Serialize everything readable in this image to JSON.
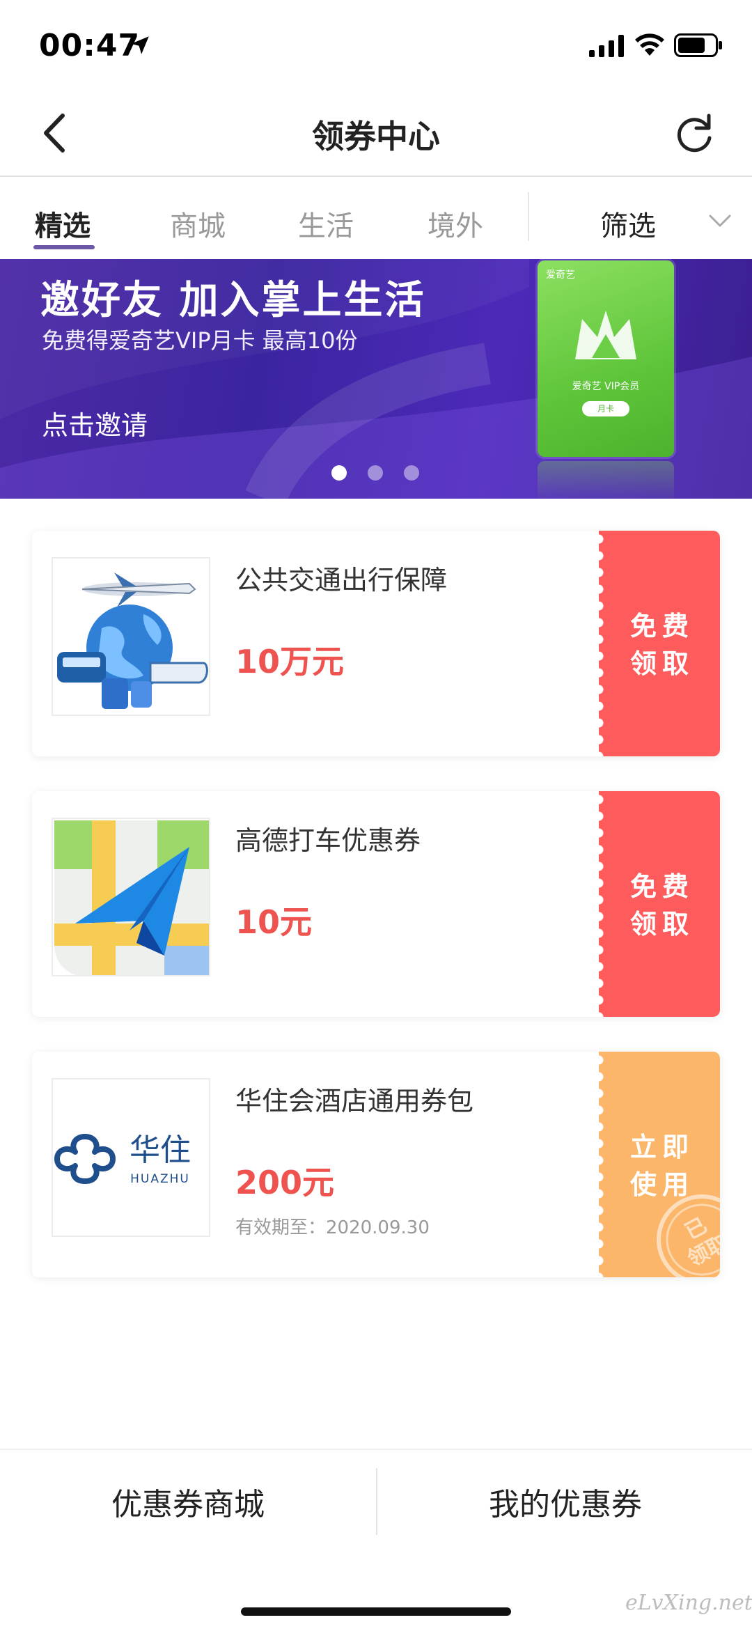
{
  "status_bar": {
    "time": "00:47"
  },
  "nav": {
    "title": "领券中心"
  },
  "tabs": {
    "items": [
      {
        "label": "精选"
      },
      {
        "label": "商城"
      },
      {
        "label": "生活"
      },
      {
        "label": "境外"
      }
    ],
    "filter_label": "筛选"
  },
  "banner": {
    "title": "邀好友 加入掌上生活",
    "subtitle": "免费得爱奇艺VIP月卡 最高10份",
    "cta": "点击邀请",
    "card": {
      "brand": "爱奇艺",
      "name": "爱奇艺 VIP会员",
      "tag": "月卡"
    },
    "dots_count": 3,
    "active_dot": 0
  },
  "coupons": [
    {
      "title": "公共交通出行保障",
      "value": "10万元",
      "valid": "",
      "action_line1": "免费",
      "action_line2": "领取",
      "action_color": "#fd5b5c"
    },
    {
      "title": "高德打车优惠券",
      "value": "10元",
      "valid": "",
      "action_line1": "免费",
      "action_line2": "领取",
      "action_color": "#fd5b5c"
    },
    {
      "title": "华住会酒店通用券包",
      "value": "200元",
      "valid": "有效期至：2020.09.30",
      "action_line1": "立即",
      "action_line2": "使用",
      "action_color": "#fbb66a",
      "stamp_line1": "已",
      "stamp_line2": "领取"
    }
  ],
  "huazhu_logo": {
    "cn": "华住",
    "en": "HUAZHU"
  },
  "bottom_bar": {
    "left_label": "优惠券商城",
    "right_label": "我的优惠券"
  },
  "watermark": "eLvXing.net",
  "colors": {
    "accent": "#6a58a6",
    "price": "#ef5350",
    "action_red": "#fd5b5c",
    "action_orange": "#fbb66a"
  }
}
